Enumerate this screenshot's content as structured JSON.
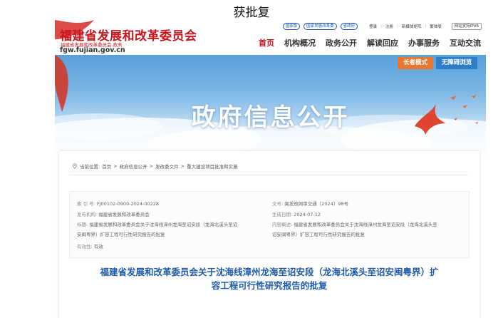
{
  "caption": "获批复",
  "header": {
    "logo_main": "福建省发展和改革委员会",
    "logo_sub": "福建省发展和改革委员会.政务",
    "logo_url": "fgw.fujian.gov.cn",
    "top_buttons": [
      "国家版",
      "国家发展改革委",
      "省政府"
    ],
    "top_links": [
      "登录",
      "注册",
      "新媒体矩阵",
      "繁体版"
    ],
    "ipv6": "网站支持IPV6",
    "nav": [
      "首页",
      "机构概况",
      "政务公开",
      "解读回应",
      "办事服务",
      "互动交流"
    ]
  },
  "banner": {
    "title": "政府信息公开",
    "elder_mode": "长者模式",
    "accessibility": "无障碍浏览"
  },
  "breadcrumb": {
    "prefix": "当前位置:",
    "items": [
      "首页",
      "政府信息公开",
      "发改委文件",
      "重大建设项目批准和实施"
    ],
    "separator": ">"
  },
  "meta": {
    "index_label": "索  引  号:",
    "index_value": "FJ00102-0900-2024-00228",
    "doc_no_label": "文号:",
    "doc_no_value": "闽发改网审交通〔2024〕98号",
    "issuer_label": "发布机构:",
    "issuer_value": "福建省发展和改革委员会",
    "date_label": "生成日期:",
    "date_value": "2024-07-12",
    "title_label": "标题:",
    "title_value_1": "福建省发展和改革委员会关于沈海线漳州龙海至诏安段（龙海北溪头至诏",
    "title_value_2": "安闽粤界）扩容工程可行性研究报告的批复",
    "summary_label": "内容概述:",
    "summary_value_1": "福建省发展和改革委员会关于沈海线漳州龙海至诏安段（龙海北溪头至",
    "summary_value_2": "诏安闽粤界）扩容工程可行性研究报告的批复",
    "validity_label": "有效性:",
    "validity_value": "有效"
  },
  "document": {
    "title_line_1": "福建省发展和改革委员会关于沈海线漳州龙海至诏安段（龙海北溪头至诏安闽粤界）扩",
    "title_line_2": "容工程可行性研究报告的批复"
  },
  "colors": {
    "brand_red": "#c8161d",
    "link_blue": "#1f5ba7",
    "elder_orange": "#e8762e",
    "access_blue": "#2f7cc9"
  }
}
